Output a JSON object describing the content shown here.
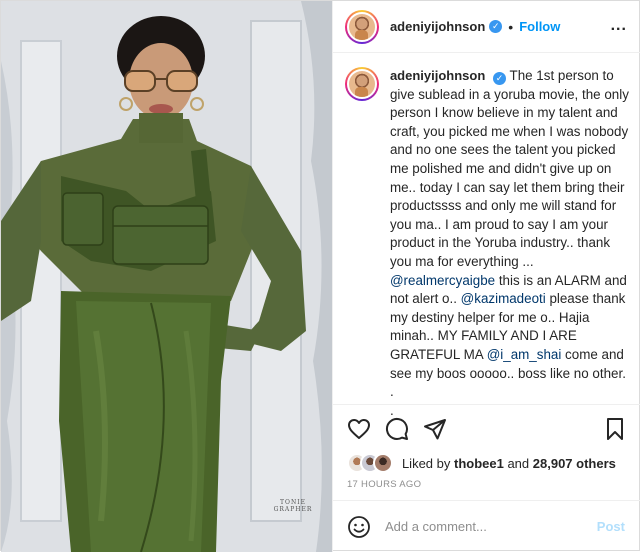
{
  "post": {
    "username": "adeniyijohnson",
    "verified_icon": "verified-badge-icon",
    "separator": "•",
    "follow_label": "Follow",
    "more_options_label": "...",
    "image_watermark_line1": "TONIE",
    "image_watermark_line2": "GRAPHER",
    "caption": {
      "part1": "The 1st person to give sublead in a yoruba movie, the only person I know believe in my talent and craft, you picked me when I was nobody and no one sees the talent you picked me polished me and didn't give up on me.. today I can say let them bring their productssss and only me will stand for you ma.. I am proud to say I am your product in the Yoruba industry.. thank you ma for everything ... ",
      "mention1": "@realmercyaigbe",
      "part2": " this is an ALARM and not alert o.. ",
      "mention2": "@kazimadeoti",
      "part3": " please thank my destiny helper for me o.. Hajia minah.. MY FAMILY AND I ARE GRATEFUL MA ",
      "mention3": "@i_am_shai",
      "part4": " come and see my boos ooooo.. boss like no other.",
      "trail1": ".",
      "trail2": "."
    },
    "likes": {
      "prefix": "Liked by ",
      "user": "thobee1",
      "middle": " and ",
      "count": "28,907 others"
    },
    "timestamp": "17 HOURS AGO",
    "comment_placeholder": "Add a comment...",
    "post_button_label": "Post"
  },
  "icons": [
    "heart-icon",
    "comment-icon",
    "share-icon",
    "bookmark-icon",
    "emoji-icon",
    "more-icon"
  ],
  "colors": {
    "accent": "#0095f6",
    "post_disabled": "#b2dffc",
    "dress": "#4f6a2e",
    "muted": "#8e8e8e"
  }
}
